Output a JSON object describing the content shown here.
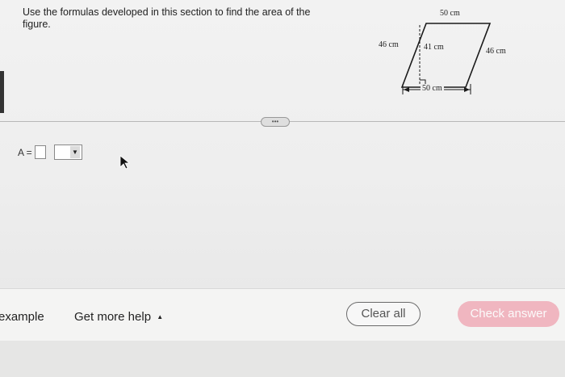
{
  "question": {
    "text": "Use the formulas developed in this section to find the area of the figure."
  },
  "figure": {
    "labels": {
      "top": "50 cm",
      "left_side": "46 cm",
      "height": "41 cm",
      "right_side": "46 cm",
      "base": "50 cm"
    }
  },
  "answer": {
    "label": "A =",
    "value": "",
    "unit_selected": ""
  },
  "expand_button": {
    "label": "•••"
  },
  "bottom_bar": {
    "example_label": "example",
    "help_label": "Get more help",
    "help_caret": "▲",
    "clear_label": "Clear all",
    "check_label": "Check answer"
  },
  "colors": {
    "check_button": "#f0b6c0",
    "figure_line": "#1a1a1a"
  }
}
